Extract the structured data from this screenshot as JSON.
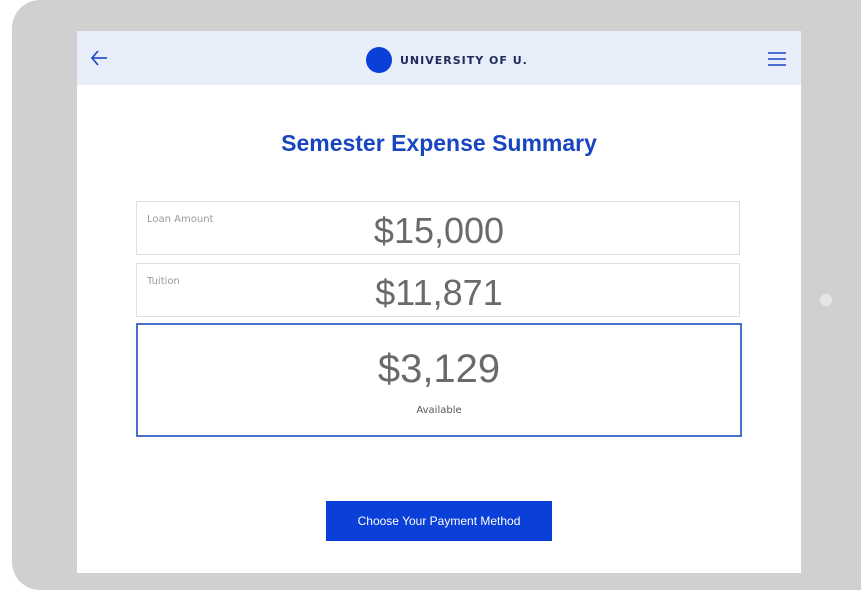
{
  "header": {
    "brand_name": "UNIVERSITY OF U.",
    "back_icon": "arrow-left-icon",
    "menu_icon": "hamburger-menu-icon"
  },
  "page": {
    "title": "Semester Expense Summary"
  },
  "loan": {
    "label": "Loan Amount",
    "value": "$15,000"
  },
  "tuition": {
    "label": "Tuition",
    "value": "$11,871"
  },
  "available": {
    "value": "$3,129",
    "label": "Available"
  },
  "cta": {
    "label": "Choose Your Payment Method"
  },
  "colors": {
    "brand_blue": "#0a3fd8",
    "title_blue": "#1846c0",
    "nav_bg": "#e7eefa",
    "available_border": "#4a6fd0"
  }
}
